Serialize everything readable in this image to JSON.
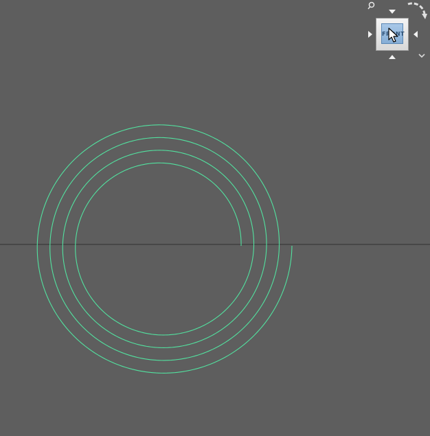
{
  "viewport": {
    "background_color": "#5e5e5e",
    "spiral_color": "#52e3a0",
    "ground_line_color": "#3a3a3a"
  },
  "viewcube": {
    "face_label": "FRONT",
    "home_icon": "home-icon",
    "rotate_icon": "rotate-arrow-icon",
    "menu_icon": "chevron-down-icon",
    "arrows": [
      "up",
      "down",
      "left",
      "right"
    ]
  },
  "cursor": {
    "icon": "mouse-pointer-icon"
  }
}
